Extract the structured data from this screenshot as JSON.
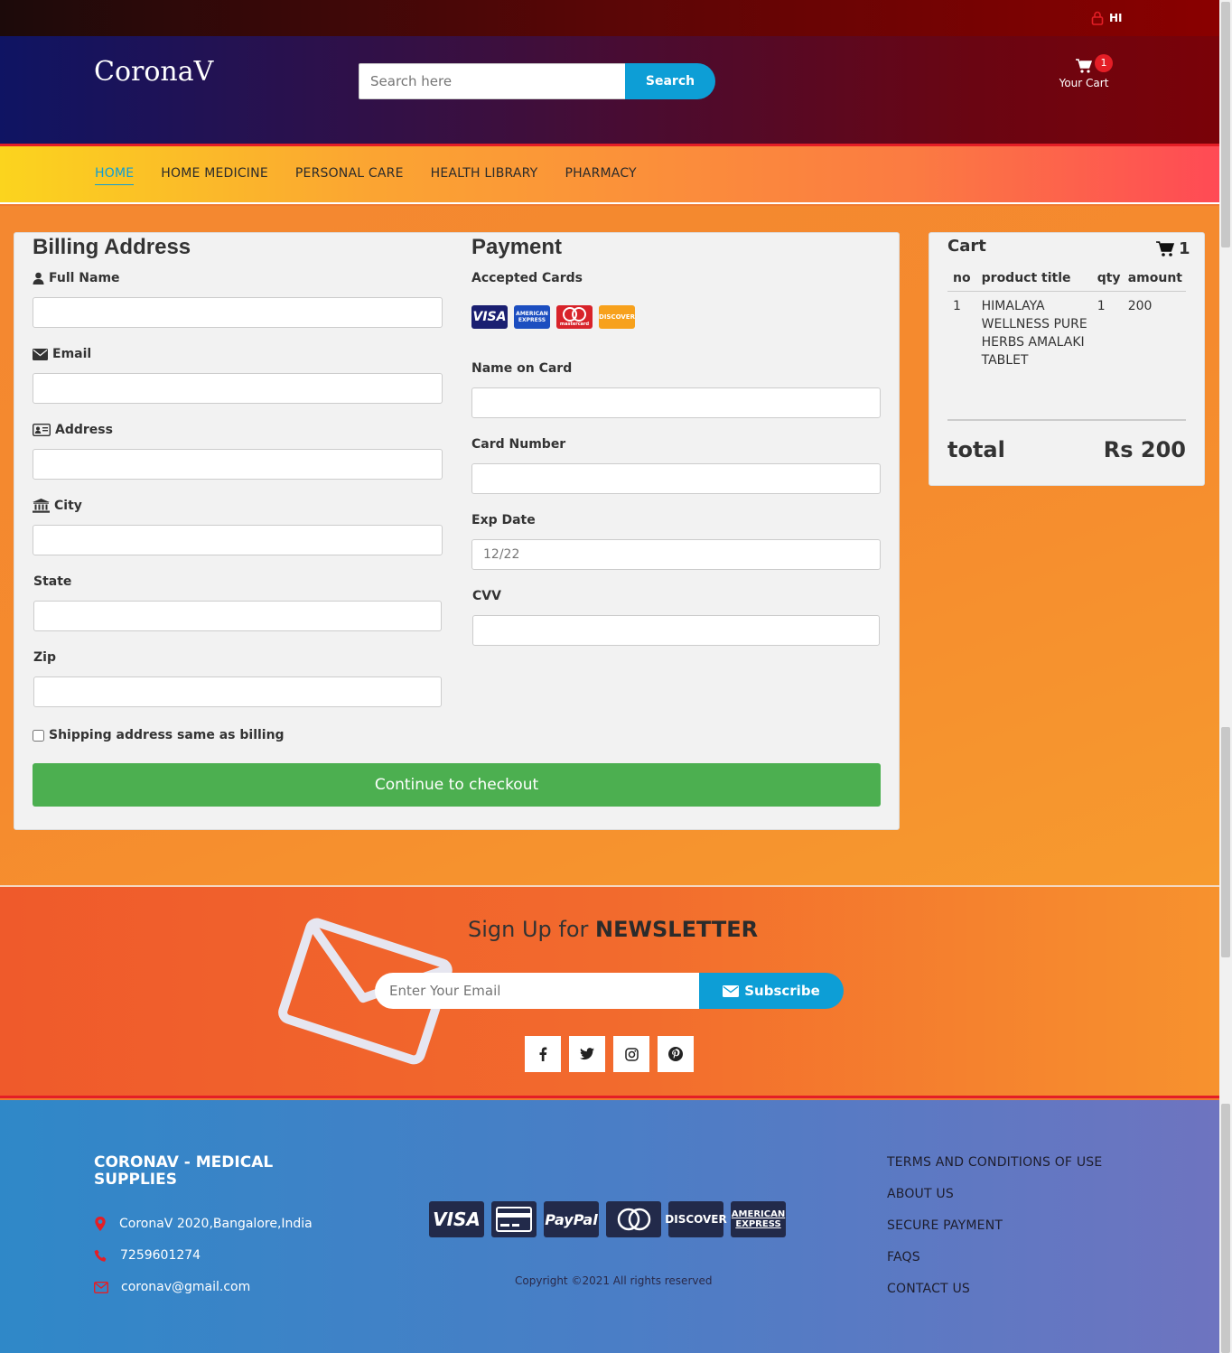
{
  "topbar": {
    "user_label": "HI"
  },
  "header": {
    "logo": "CoronaV",
    "search_placeholder": "Search here",
    "search_button": "Search",
    "cart_label": "Your Cart",
    "cart_count": "1"
  },
  "nav": {
    "items": [
      "HOME",
      "HOME MEDICINE",
      "PERSONAL CARE",
      "HEALTH LIBRARY",
      "PHARMACY"
    ]
  },
  "billing": {
    "title": "Billing Address",
    "full_name": "Full Name",
    "email": "Email",
    "address": "Address",
    "city": "City",
    "state": "State",
    "zip": "Zip",
    "shipping_same": "Shipping address same as billing"
  },
  "payment": {
    "title": "Payment",
    "accepted_cards": "Accepted Cards",
    "card_logos": [
      "VISA",
      "AMERICAN EXPRESS",
      "mastercard",
      "DISCOVER"
    ],
    "name_on_card": "Name on Card",
    "card_number": "Card Number",
    "exp_date": "Exp Date",
    "exp_placeholder": "12/22",
    "cvv": "CVV"
  },
  "checkout_button": "Continue to checkout",
  "cart": {
    "title": "Cart",
    "count": "1",
    "headers": [
      "no",
      "product title",
      "qty",
      "amount"
    ],
    "rows": [
      {
        "no": "1",
        "title": "HIMALAYA WELLNESS PURE HERBS AMALAKI TABLET",
        "qty": "1",
        "amount": "200"
      }
    ],
    "total_label": "total",
    "total_value": "Rs 200"
  },
  "newsletter": {
    "title_pre": "Sign Up for ",
    "title_bold": "NEWSLETTER",
    "email_placeholder": "Enter Your Email",
    "subscribe": "Subscribe"
  },
  "footer": {
    "title": "CORONAV - MEDICAL SUPPLIES",
    "address": "CoronaV 2020,Bangalore,India",
    "phone": "7259601274",
    "email": "coronav@gmail.com",
    "payment_logos": [
      "VISA",
      "PayPal",
      "DISCOVER",
      "AMERICAN EXPRESS"
    ],
    "copyright": "Copyright ©2021 All rights reserved",
    "links": [
      "TERMS AND CONDITIONS OF USE",
      "ABOUT US",
      "SECURE PAYMENT",
      "FAQS",
      "CONTACT US"
    ]
  },
  "colors": {
    "accent": "#0d9ed6",
    "danger": "#e41e26",
    "success": "#4caf50"
  }
}
